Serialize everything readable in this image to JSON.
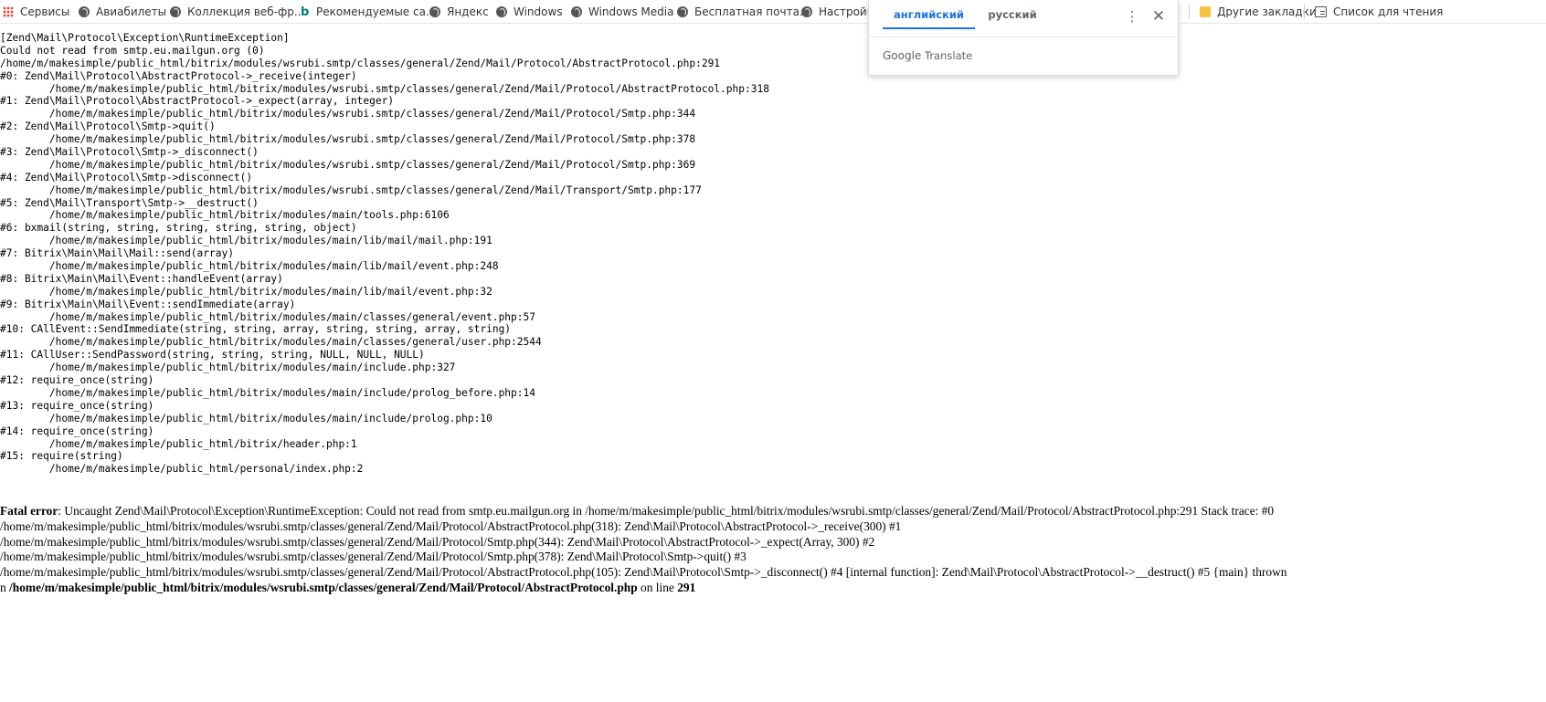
{
  "bookmarks": [
    {
      "label": "Сервисы",
      "icon": "apps-grid-icon"
    },
    {
      "label": "Авиабилеты",
      "icon": "globe-icon"
    },
    {
      "label": "Коллекция веб-фр...",
      "icon": "globe-icon"
    },
    {
      "label": "Рекомендуемые са...",
      "icon": "bing-icon"
    },
    {
      "label": "Яндекс",
      "icon": "globe-icon"
    },
    {
      "label": "Windows",
      "icon": "globe-icon"
    },
    {
      "label": "Windows Media",
      "icon": "globe-icon"
    },
    {
      "label": "Бесплатная почта...",
      "icon": "globe-icon"
    },
    {
      "label": "Настройка",
      "icon": "globe-icon"
    }
  ],
  "bookmarks_right": {
    "other": "Другие закладки",
    "reading_list": "Список для чтения"
  },
  "translate": {
    "tab_source": "английский",
    "tab_target": "русский",
    "more_icon": "more-vert-icon",
    "close_icon": "close-icon",
    "brand_google": "Google",
    "brand_translate": "Translate"
  },
  "trace_lines": [
    "[Zend\\Mail\\Protocol\\Exception\\RuntimeException]",
    "Could not read from smtp.eu.mailgun.org (0)",
    "/home/m/makesimple/public_html/bitrix/modules/wsrubi.smtp/classes/general/Zend/Mail/Protocol/AbstractProtocol.php:291",
    "#0: Zend\\Mail\\Protocol\\AbstractProtocol->_receive(integer)",
    "        /home/m/makesimple/public_html/bitrix/modules/wsrubi.smtp/classes/general/Zend/Mail/Protocol/AbstractProtocol.php:318",
    "#1: Zend\\Mail\\Protocol\\AbstractProtocol->_expect(array, integer)",
    "        /home/m/makesimple/public_html/bitrix/modules/wsrubi.smtp/classes/general/Zend/Mail/Protocol/Smtp.php:344",
    "#2: Zend\\Mail\\Protocol\\Smtp->quit()",
    "        /home/m/makesimple/public_html/bitrix/modules/wsrubi.smtp/classes/general/Zend/Mail/Protocol/Smtp.php:378",
    "#3: Zend\\Mail\\Protocol\\Smtp->_disconnect()",
    "        /home/m/makesimple/public_html/bitrix/modules/wsrubi.smtp/classes/general/Zend/Mail/Protocol/Smtp.php:369",
    "#4: Zend\\Mail\\Protocol\\Smtp->disconnect()",
    "        /home/m/makesimple/public_html/bitrix/modules/wsrubi.smtp/classes/general/Zend/Mail/Transport/Smtp.php:177",
    "#5: Zend\\Mail\\Transport\\Smtp->__destruct()",
    "        /home/m/makesimple/public_html/bitrix/modules/main/tools.php:6106",
    "#6: bxmail(string, string, string, string, string, object)",
    "        /home/m/makesimple/public_html/bitrix/modules/main/lib/mail/mail.php:191",
    "#7: Bitrix\\Main\\Mail\\Mail::send(array)",
    "        /home/m/makesimple/public_html/bitrix/modules/main/lib/mail/event.php:248",
    "#8: Bitrix\\Main\\Mail\\Event::handleEvent(array)",
    "        /home/m/makesimple/public_html/bitrix/modules/main/lib/mail/event.php:32",
    "#9: Bitrix\\Main\\Mail\\Event::sendImmediate(array)",
    "        /home/m/makesimple/public_html/bitrix/modules/main/classes/general/event.php:57",
    "#10: CAllEvent::SendImmediate(string, string, array, string, string, array, string)",
    "        /home/m/makesimple/public_html/bitrix/modules/main/classes/general/user.php:2544",
    "#11: CAllUser::SendPassword(string, string, string, NULL, NULL, NULL)",
    "        /home/m/makesimple/public_html/bitrix/modules/main/include.php:327",
    "#12: require_once(string)",
    "        /home/m/makesimple/public_html/bitrix/modules/main/include/prolog_before.php:14",
    "#13: require_once(string)",
    "        /home/m/makesimple/public_html/bitrix/modules/main/include/prolog.php:10",
    "#14: require_once(string)",
    "        /home/m/makesimple/public_html/bitrix/header.php:1",
    "#15: require(string)",
    "        /home/m/makesimple/public_html/personal/index.php:2"
  ],
  "fatal": {
    "label": "Fatal error",
    "line1_rest": ": Uncaught Zend\\Mail\\Protocol\\Exception\\RuntimeException: Could not read from smtp.eu.mailgun.org in /home/m/makesimple/public_html/bitrix/modules/wsrubi.smtp/classes/general/Zend/Mail/Protocol/AbstractProtocol.php:291 Stack trace: #0",
    "line2": "/home/m/makesimple/public_html/bitrix/modules/wsrubi.smtp/classes/general/Zend/Mail/Protocol/AbstractProtocol.php(318): Zend\\Mail\\Protocol\\AbstractProtocol->_receive(300) #1",
    "line3": "/home/m/makesimple/public_html/bitrix/modules/wsrubi.smtp/classes/general/Zend/Mail/Protocol/Smtp.php(344): Zend\\Mail\\Protocol\\AbstractProtocol->_expect(Array, 300) #2",
    "line4": "/home/m/makesimple/public_html/bitrix/modules/wsrubi.smtp/classes/general/Zend/Mail/Protocol/Smtp.php(378): Zend\\Mail\\Protocol\\Smtp->quit() #3",
    "line5": "/home/m/makesimple/public_html/bitrix/modules/wsrubi.smtp/classes/general/Zend/Mail/Protocol/AbstractProtocol.php(105): Zend\\Mail\\Protocol\\Smtp->_disconnect() #4 [internal function]: Zend\\Mail\\Protocol\\AbstractProtocol->__destruct() #5 {main} thrown",
    "line6_prefix": "n ",
    "line6_file": "/home/m/makesimple/public_html/bitrix/modules/wsrubi.smtp/classes/general/Zend/Mail/Protocol/AbstractProtocol.php",
    "line6_mid": " on line ",
    "line6_num": "291"
  }
}
